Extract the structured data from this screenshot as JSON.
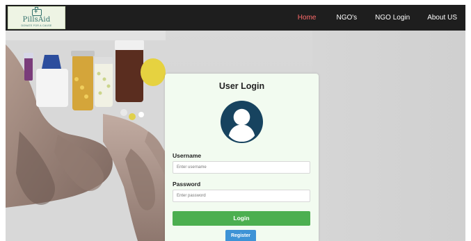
{
  "brand": {
    "name": "PillsAid",
    "tagline": "DONATE FOR A CAUSE",
    "icon": "medical-kit-icon"
  },
  "nav": {
    "items": [
      {
        "label": "Home",
        "active": true
      },
      {
        "label": "NGO's",
        "active": false
      },
      {
        "label": "NGO Login",
        "active": false
      },
      {
        "label": "About US",
        "active": false
      }
    ]
  },
  "login": {
    "title": "User Login",
    "avatar_icon": "user-avatar-icon",
    "username_label": "Username",
    "username_placeholder": "Enter username",
    "password_label": "Password",
    "password_placeholder": "Enter password",
    "login_label": "Login",
    "register_label": "Register"
  },
  "colors": {
    "navbar": "#1e1e1e",
    "active_nav": "#ff6b6b",
    "login_button": "#4caf50",
    "register_button": "#3e93d6",
    "card_background": "#f2fbf0",
    "avatar": "#17435f"
  }
}
